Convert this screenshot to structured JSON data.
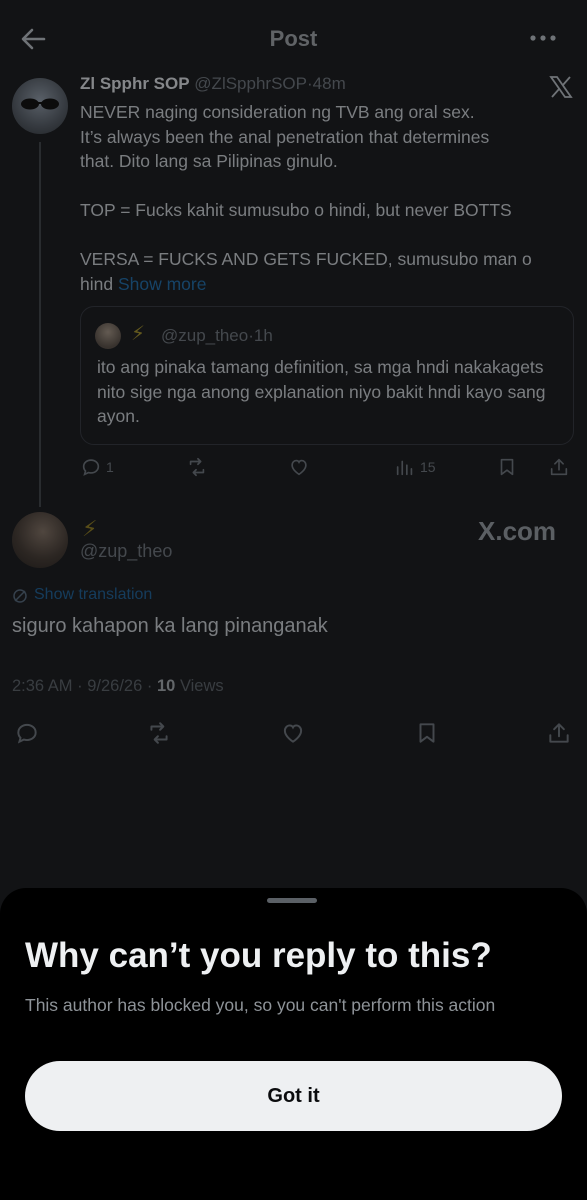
{
  "header": {
    "title": "Post",
    "back_icon": "arrow-left-icon",
    "more_icon": "more-horizontal-icon"
  },
  "post": {
    "author_name": "Zl Spphr SOP",
    "handle": "@ZlSpphrSOP",
    "time": "48m",
    "body": "NEVER naging consideration ng TVB ang oral sex.\nIt’s always been the anal penetration that determines\nthat. Dito lang sa Pilipinas ginulo.\n\nTOP = Fucks kahit sumusubo o hindi, but never BOTTS\n\nVERSA = FUCKS AND GETS FUCKED, sumusubo man o\nhind ",
    "show_more": "Show more",
    "quote": {
      "name": "⚡",
      "handle": "@zup_theo",
      "time": "1h",
      "body": "ito ang pinaka tamang definition, sa mga hndi nakakagets nito sige nga anong explanation niyo bakit hndi kayo sang ayon."
    },
    "actions": {
      "replies": "1",
      "reposts": "",
      "likes": "",
      "views": "15"
    }
  },
  "reply": {
    "name": "⚡",
    "handle": "@zup_theo",
    "watermark": "X.com",
    "show_translation": "Show translation",
    "text": "siguro kahapon ka lang pinanganak",
    "time": "2:36 AM",
    "date": "9/26/26",
    "views_count": "10",
    "views_label": "Views",
    "separator": "·"
  },
  "sheet": {
    "title": "Why can’t you reply to this?",
    "description": "This author has blocked you, so you can't perform this action",
    "button_label": "Got it"
  },
  "colors": {
    "background": "#1a1b1e",
    "sheet": "#000000",
    "link": "#1d9bf0",
    "button": "#eef0f2"
  }
}
